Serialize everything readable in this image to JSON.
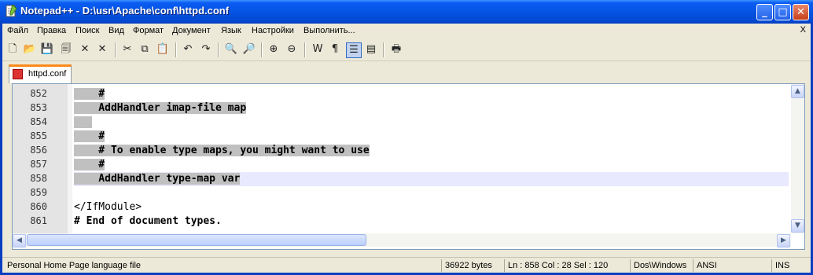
{
  "window": {
    "title": "Notepad++ - D:\\usr\\Apache\\conf\\httpd.conf",
    "minimize": "_",
    "maximize": "□",
    "close": "✕"
  },
  "menu": [
    "Файл",
    "Правка",
    "Поиск",
    "Вид",
    "Формат",
    "Документ",
    "Язык",
    "Настройки",
    "Выполнить..."
  ],
  "menu_close": "X",
  "toolbar_icons": [
    "new-icon",
    "open-icon",
    "save-icon",
    "save-all-icon",
    "close-icon",
    "close-all-icon",
    "cut-icon",
    "copy-icon",
    "paste-icon",
    "undo-icon",
    "redo-icon",
    "find-icon",
    "replace-icon",
    "zoom-in-icon",
    "zoom-out-icon",
    "wrap-icon",
    "show-all-chars-icon",
    "indent-guide-icon",
    "user-lang-icon",
    "print-icon"
  ],
  "tab": {
    "label": "httpd.conf"
  },
  "editor": {
    "lines": [
      {
        "num": "852",
        "text": "    #",
        "selected": true
      },
      {
        "num": "853",
        "text": "    AddHandler imap-file map",
        "selected": true
      },
      {
        "num": "854",
        "text": "",
        "selected": true
      },
      {
        "num": "855",
        "text": "    #",
        "selected": true
      },
      {
        "num": "856",
        "text": "    # To enable type maps, you might want to use",
        "selected": true
      },
      {
        "num": "857",
        "text": "    #",
        "selected": true
      },
      {
        "num": "858",
        "text": "    AddHandler type-map var",
        "selected": true,
        "current": true
      },
      {
        "num": "859",
        "text": "",
        "selected": false
      },
      {
        "num": "860",
        "text": "</IfModule>",
        "selected": false
      },
      {
        "num": "861",
        "text": "# End of document types.",
        "selected": false
      }
    ]
  },
  "status": {
    "language": "Personal Home Page language file",
    "size": "36922 bytes",
    "position": "Ln : 858   Col : 28   Sel : 120",
    "eol": "Dos\\Windows",
    "encoding": "ANSI",
    "mode": "INS"
  }
}
